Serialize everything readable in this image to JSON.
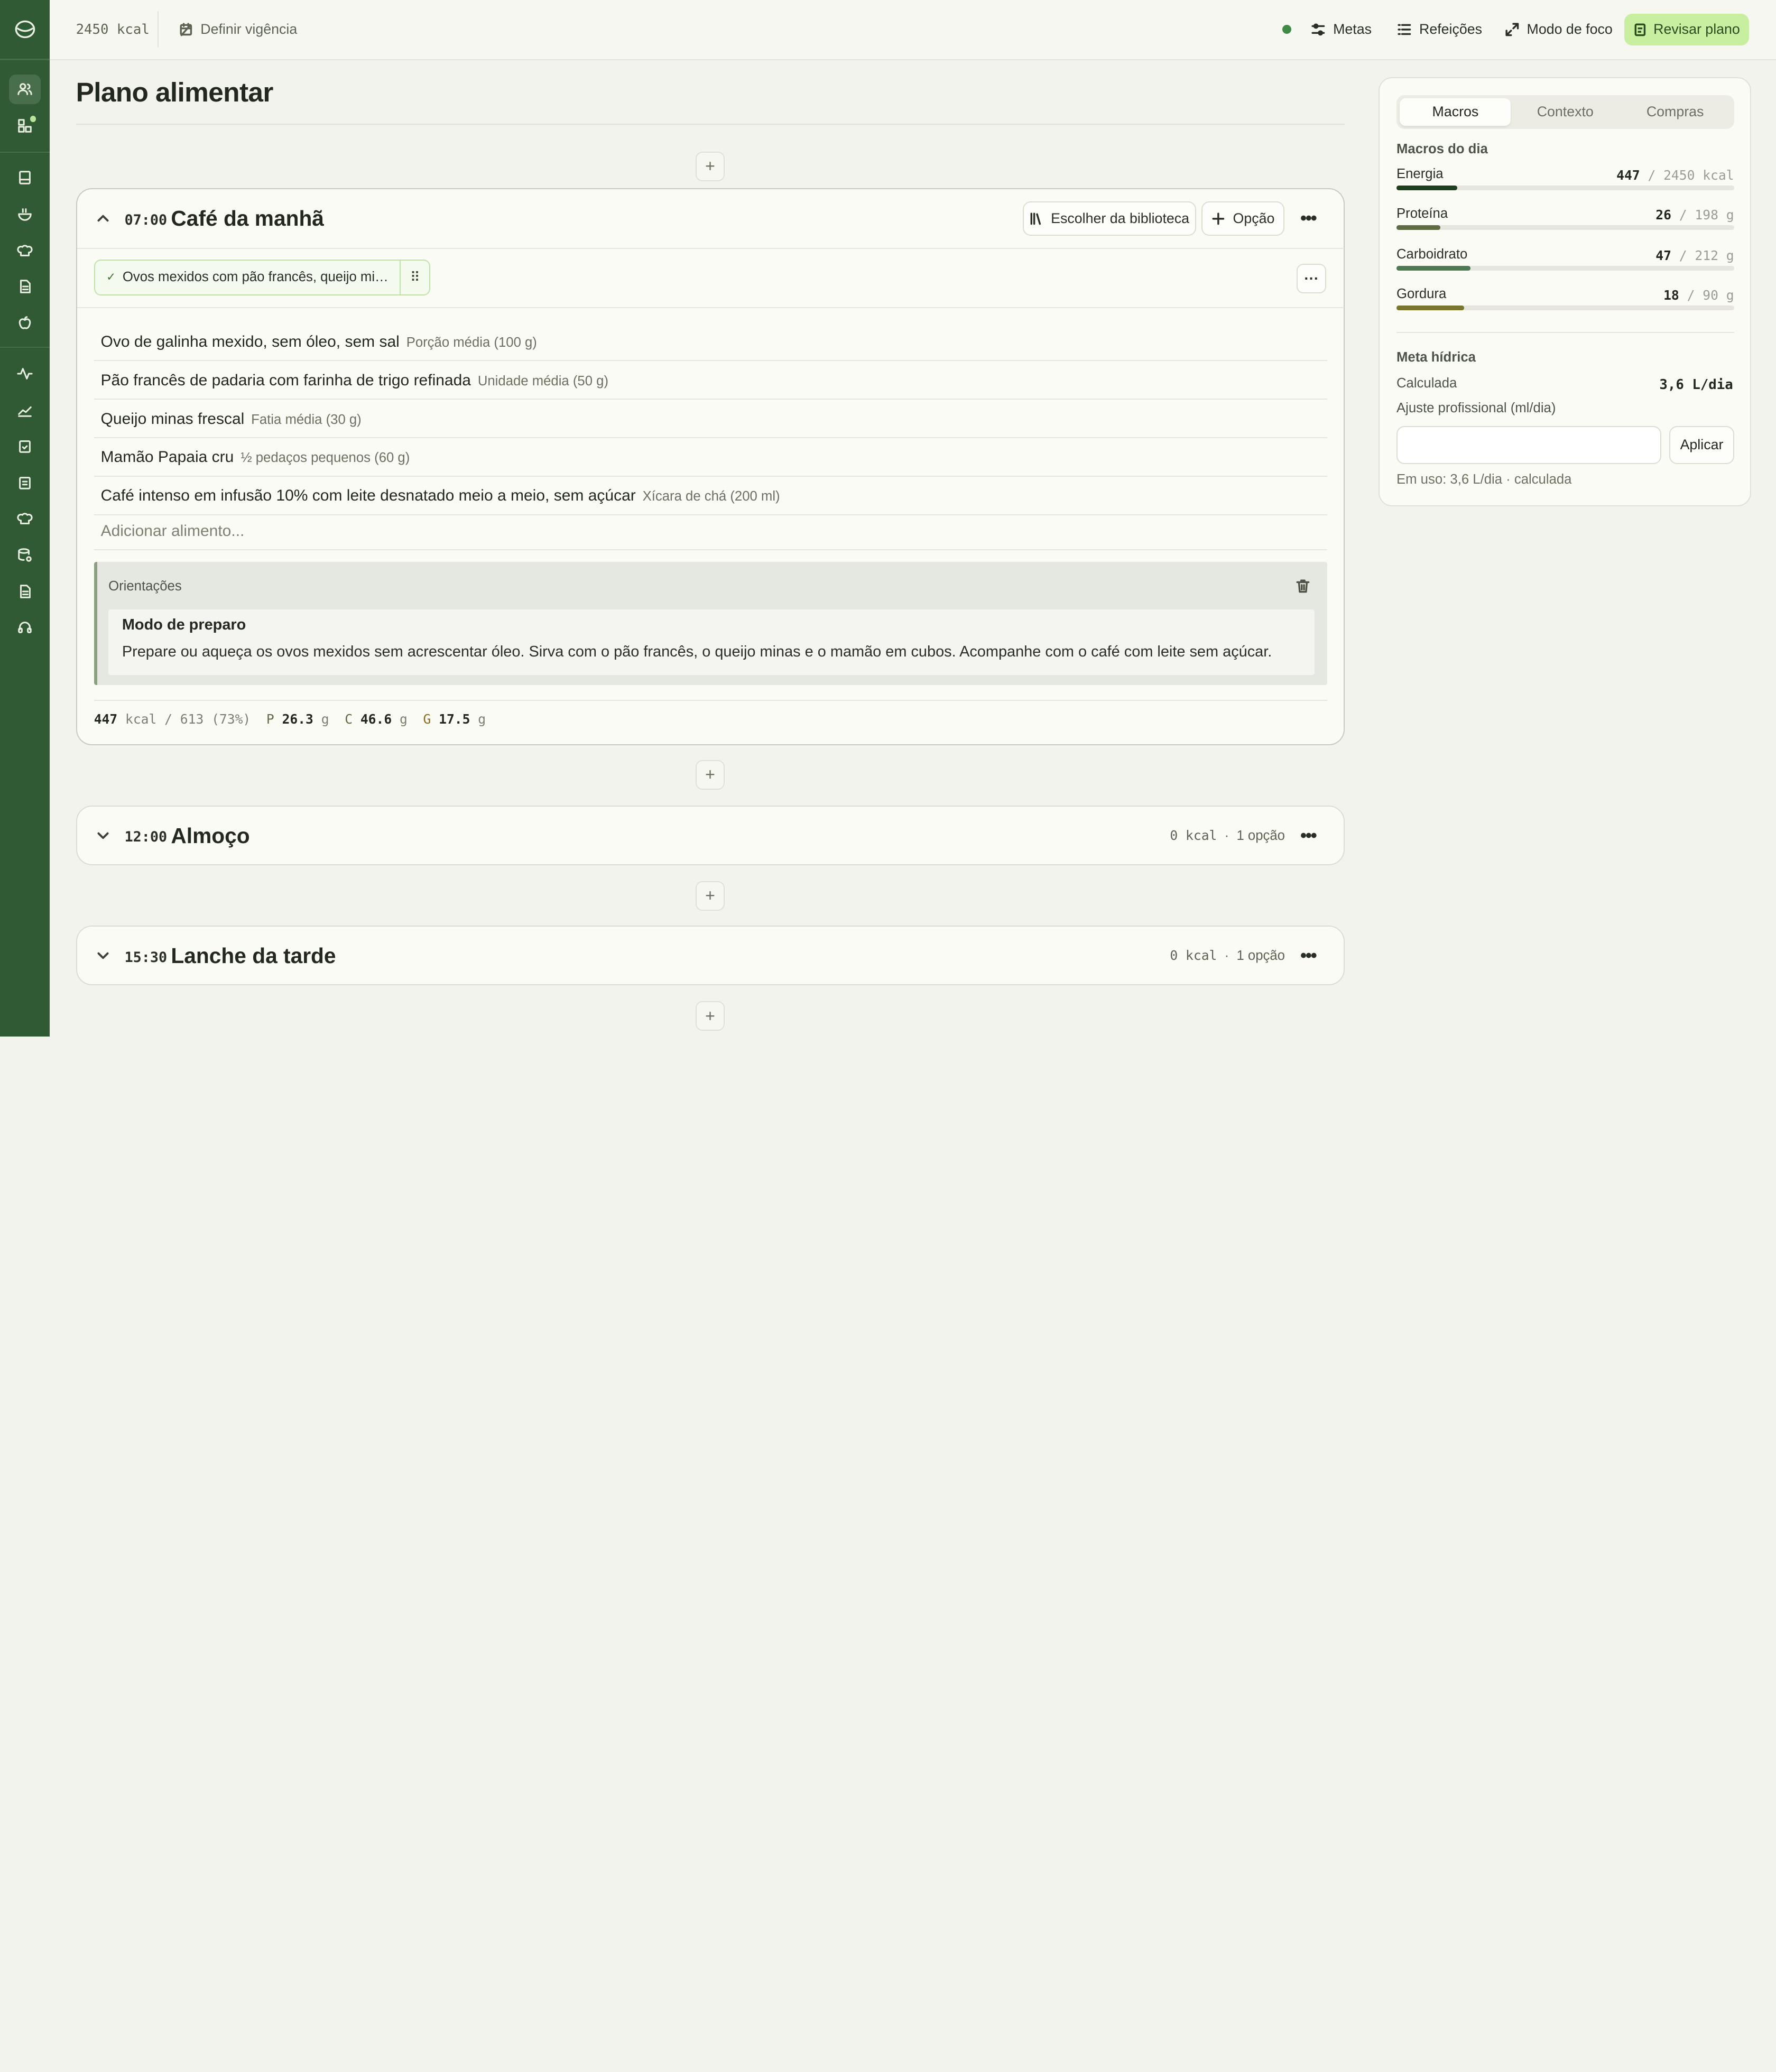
{
  "topbar": {
    "kcal": "2450 kcal",
    "set_validity": "Definir vigência",
    "goals": "Metas",
    "meals": "Refeições",
    "focus_mode": "Modo de foco",
    "review_plan": "Revisar plano",
    "status_color": "#3f8a44"
  },
  "page": {
    "title": "Plano alimentar"
  },
  "meals": [
    {
      "time": "07:00",
      "name": "Café da manhã",
      "library_label": "Escolher da biblioteca",
      "option_label": "Opção",
      "selected_option": "Ovos mexidos com pão francês, queijo minas e mamão",
      "foods": [
        {
          "name": "Ovo de galinha mexido, sem óleo, sem sal",
          "portion": "Porção média (100 g)"
        },
        {
          "name": "Pão francês de padaria com farinha de trigo refinada",
          "portion": "Unidade média (50 g)"
        },
        {
          "name": "Queijo minas frescal",
          "portion": "Fatia média (30 g)"
        },
        {
          "name": "Mamão Papaia cru",
          "portion": "½ pedaços pequenos (60 g)"
        },
        {
          "name": "Café intenso em infusão 10% com leite desnatado meio a meio, sem açúcar",
          "portion": "Xícara de chá (200 ml)"
        }
      ],
      "add_food_placeholder": "Adicionar alimento...",
      "guidance": {
        "title": "Orientações",
        "heading": "Modo de preparo",
        "text": "Prepare ou aqueça os ovos mexidos sem acrescentar óleo. Sirva com o pão francês, o queijo minas e o mamão em cubos. Acompanhe com o café com leite sem açúcar."
      },
      "totals": {
        "kcal": "447",
        "kcal_unit": "kcal",
        "target": "/ 613 (73%)",
        "p_label": "P",
        "p": "26.3",
        "p_unit": "g",
        "c_label": "C",
        "c": "46.6",
        "c_unit": "g",
        "g_label": "G",
        "g": "17.5",
        "g_unit": "g"
      }
    },
    {
      "time": "12:00",
      "name": "Almoço",
      "kcal": "0 kcal",
      "options": "1 opção"
    },
    {
      "time": "15:30",
      "name": "Lanche da tarde",
      "kcal": "0 kcal",
      "options": "1 opção"
    }
  ],
  "panel": {
    "tabs": [
      "Macros",
      "Contexto",
      "Compras"
    ],
    "macros_title": "Macros do dia",
    "macros": [
      {
        "name": "Energia",
        "value": "447",
        "target": "/ 2450 kcal",
        "fraction": 0.18,
        "color": "#1f3f1f"
      },
      {
        "name": "Proteína",
        "value": "26",
        "target": "/ 198 g",
        "fraction": 0.13,
        "color": "#5f6b45"
      },
      {
        "name": "Carboidrato",
        "value": "47",
        "target": "/ 212 g",
        "fraction": 0.22,
        "color": "#4d7a52"
      },
      {
        "name": "Gordura",
        "value": "18",
        "target": "/ 90 g",
        "fraction": 0.2,
        "color": "#7a7630"
      }
    ],
    "water": {
      "title": "Meta hídrica",
      "calculated_label": "Calculada",
      "calculated_value": "3,6 L/dia",
      "adjust_label": "Ajuste profissional (ml/dia)",
      "input_value": "",
      "apply": "Aplicar",
      "in_use": "Em uso: 3,6 L/dia · calculada"
    }
  }
}
